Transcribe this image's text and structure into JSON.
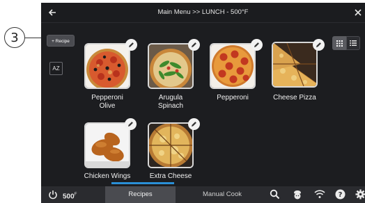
{
  "callout": {
    "number": "3"
  },
  "header": {
    "title": "Main Menu >> LUNCH - 500°F"
  },
  "sidebar": {
    "add_recipe_label": "+ Recipe",
    "sort_label": "AZ"
  },
  "recipes": [
    {
      "name": "Pepperoni\nOlive"
    },
    {
      "name": "Arugula\nSpinach"
    },
    {
      "name": "Pepperoni"
    },
    {
      "name": "Cheese Pizza"
    },
    {
      "name": "Chicken Wings"
    },
    {
      "name": "Extra Cheese"
    }
  ],
  "bottom_bar": {
    "temperature": "500",
    "temperature_unit": "F",
    "tabs": [
      {
        "label": "Recipes"
      },
      {
        "label": "Manual Cook"
      }
    ]
  },
  "icons": [
    "back-arrow-icon",
    "close-icon",
    "grid-view-icon",
    "list-view-icon",
    "pencil-icon",
    "power-icon",
    "search-icon",
    "chef-icon",
    "wifi-icon",
    "help-icon",
    "gear-icon"
  ],
  "colors": {
    "background": "#1c1d20",
    "bottom_bar": "#2a2b2f",
    "active_tab": "#4a4b50",
    "scroll_indicator": "#2a8fd6"
  }
}
